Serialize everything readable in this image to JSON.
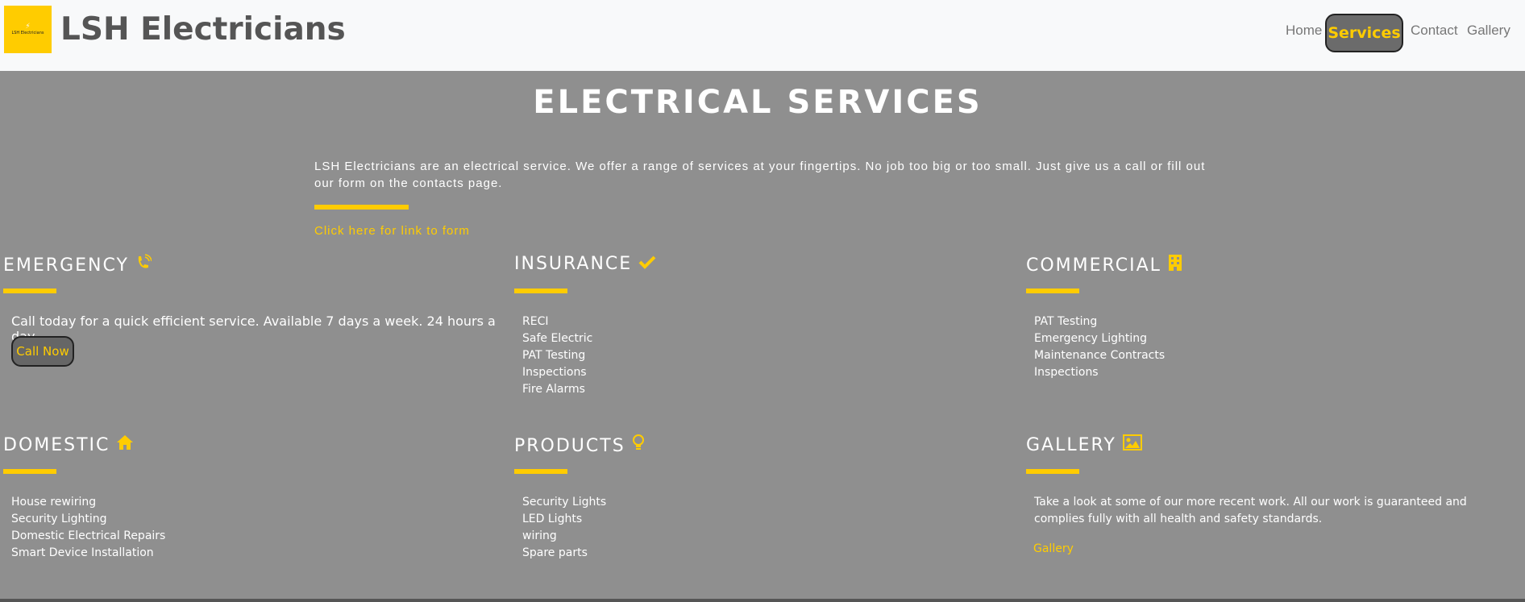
{
  "navbar": {
    "logo_text": "LSH Electricians",
    "brand": "LSH Electricians",
    "links": [
      "Home",
      "Services",
      "Contact",
      "Gallery"
    ],
    "active": "Services"
  },
  "page": {
    "title": "ELECTRICAL SERVICES",
    "intro": "LSH Electricians are an electrical service. We offer a range of services at your fingertips. No job too big or too small. Just give us a call or fill out our form on the contacts page.",
    "form_link": "Click here for link to form"
  },
  "sections": {
    "emergency": {
      "title": "EMERGENCY",
      "icon": "phone-ringing-icon",
      "text": "Call today for a quick efficient service. Available 7 days a week. 24 hours a day.",
      "button": "Call Now"
    },
    "insurance": {
      "title": "INSURANCE",
      "icon": "checkmark-icon",
      "items": [
        "RECI",
        "Safe Electric",
        "PAT Testing",
        "Inspections",
        "Fire Alarms"
      ]
    },
    "commercial": {
      "title": "COMMERCIAL",
      "icon": "building-icon",
      "items": [
        "PAT Testing",
        "Emergency Lighting",
        "Maintenance Contracts",
        "Inspections"
      ]
    },
    "domestic": {
      "title": "DOMESTIC",
      "icon": "home-icon",
      "items": [
        "House rewiring",
        "Security Lighting",
        "Domestic Electrical Repairs",
        "Smart Device Installation"
      ]
    },
    "products": {
      "title": "PRODUCTS",
      "icon": "lightbulb-icon",
      "items": [
        "Security Lights",
        "LED Lights",
        "wiring",
        "Spare parts"
      ]
    },
    "gallery": {
      "title": "GALLERY",
      "icon": "image-icon",
      "text": "Take a look at some of our more recent work. All our work is guaranteed and complies fully with all health and safety standards.",
      "link": "Gallery"
    }
  },
  "colors": {
    "accent": "#ffcc00",
    "background": "#8f8f8f",
    "navbar": "#f8f9fa"
  }
}
